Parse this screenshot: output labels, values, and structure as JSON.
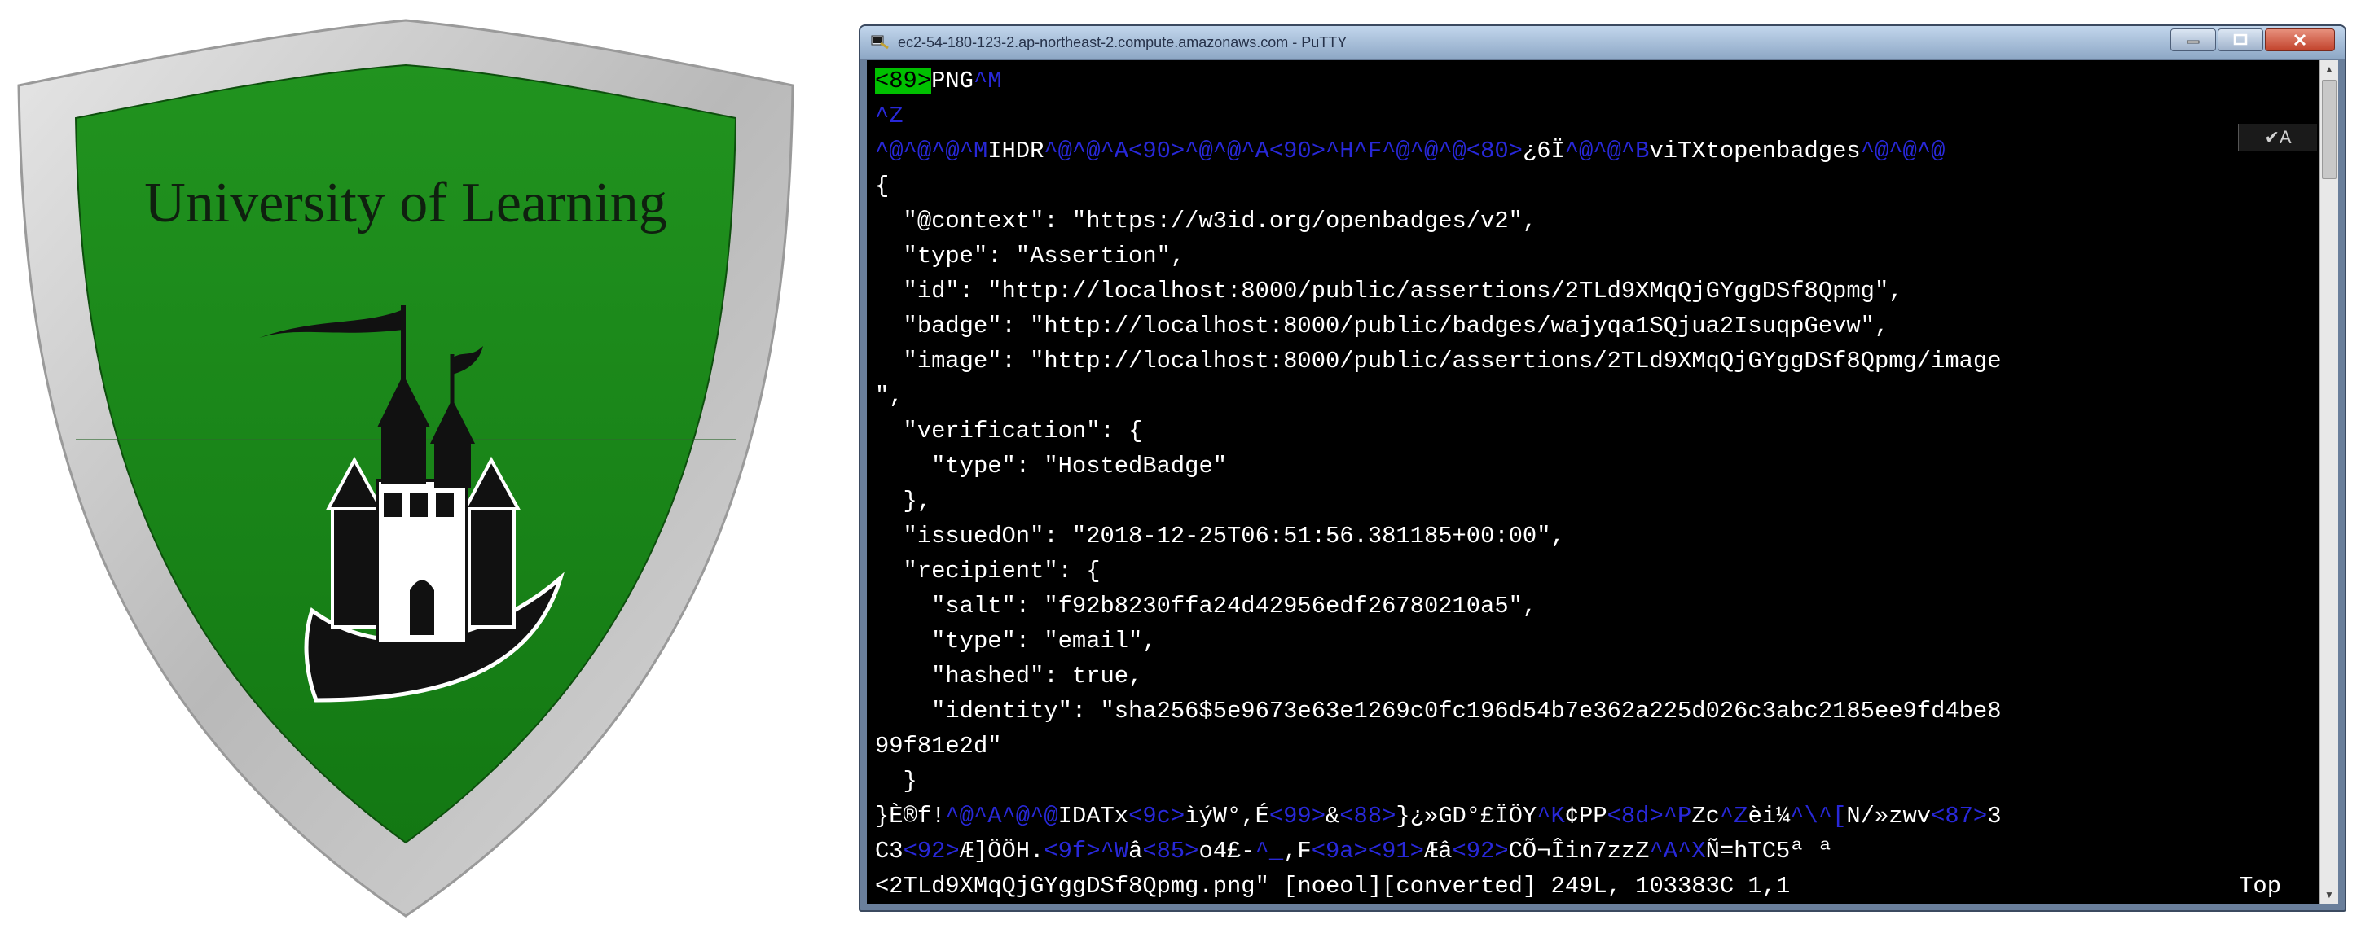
{
  "badge": {
    "title": "University of Learning",
    "colors": {
      "shield_border": "#c4c4c4",
      "shield_fill": "#1e8a1e",
      "ink": "#111111"
    }
  },
  "window": {
    "title": "ec2-54-180-123-2.ap-northeast-2.compute.amazonaws.com - PuTTY",
    "icon": "putty-icon",
    "controls": [
      "minimize-icon",
      "maximize-icon",
      "close-icon"
    ]
  },
  "terminal": {
    "segments": [
      [
        {
          "t": "<89>",
          "c": "cursor"
        },
        {
          "t": "PNG"
        },
        {
          "t": "^M",
          "c": "ctrl"
        }
      ],
      [
        {
          "t": "^Z",
          "c": "ctrl"
        }
      ],
      [
        {
          "t": "^@^@^@^M",
          "c": "ctrl"
        },
        {
          "t": "IHDR"
        },
        {
          "t": "^@^@^A<90>^@^@^A<90>^H^F^@^@^@<80>",
          "c": "ctrl"
        },
        {
          "t": "¿6Ï"
        },
        {
          "t": "^@^@^B",
          "c": "ctrl"
        },
        {
          "t": "viTXtopenbadges"
        },
        {
          "t": "^@^@^@",
          "c": "ctrl"
        }
      ],
      [
        {
          "t": "{"
        }
      ],
      [
        {
          "t": "  \"@context\": \"https://w3id.org/openbadges/v2\","
        }
      ],
      [
        {
          "t": "  \"type\": \"Assertion\","
        }
      ],
      [
        {
          "t": "  \"id\": \"http://localhost:8000/public/assertions/2TLd9XMqQjGYggDSf8Qpmg\","
        }
      ],
      [
        {
          "t": "  \"badge\": \"http://localhost:8000/public/badges/wajyqa1SQjua2IsuqpGevw\","
        }
      ],
      [
        {
          "t": "  \"image\": \"http://localhost:8000/public/assertions/2TLd9XMqQjGYggDSf8Qpmg/image"
        }
      ],
      [
        {
          "t": "\","
        }
      ],
      [
        {
          "t": "  \"verification\": {"
        }
      ],
      [
        {
          "t": "    \"type\": \"HostedBadge\""
        }
      ],
      [
        {
          "t": "  },"
        }
      ],
      [
        {
          "t": "  \"issuedOn\": \"2018-12-25T06:51:56.381185+00:00\","
        }
      ],
      [
        {
          "t": "  \"recipient\": {"
        }
      ],
      [
        {
          "t": "    \"salt\": \"f92b8230ffa24d42956edf26780210a5\","
        }
      ],
      [
        {
          "t": "    \"type\": \"email\","
        }
      ],
      [
        {
          "t": "    \"hashed\": true,"
        }
      ],
      [
        {
          "t": "    \"identity\": \"sha256$5e9673e63e1269c0fc196d54b7e362a225d026c3abc2185ee9fd4be8"
        }
      ],
      [
        {
          "t": "99f81e2d\""
        }
      ],
      [
        {
          "t": "  }"
        }
      ],
      [
        {
          "t": "}È®f!"
        },
        {
          "t": "^@^A^@^@",
          "c": "ctrl"
        },
        {
          "t": "IDATx"
        },
        {
          "t": "<9c>",
          "c": "ctrl"
        },
        {
          "t": "ìýW°,É"
        },
        {
          "t": "<99>",
          "c": "ctrl"
        },
        {
          "t": "&"
        },
        {
          "t": "<88>",
          "c": "ctrl"
        },
        {
          "t": "}¿»GD°£ÏÖY"
        },
        {
          "t": "^K",
          "c": "ctrl"
        },
        {
          "t": "¢PP"
        },
        {
          "t": "<8d>^P",
          "c": "ctrl"
        },
        {
          "t": "Zc"
        },
        {
          "t": "^Z",
          "c": "ctrl"
        },
        {
          "t": "èi¼"
        },
        {
          "t": "^\\^[",
          "c": "ctrl"
        },
        {
          "t": "N/»zwv"
        },
        {
          "t": "<87>",
          "c": "ctrl"
        },
        {
          "t": "3"
        }
      ],
      [
        {
          "t": "C3"
        },
        {
          "t": "<92>",
          "c": "ctrl"
        },
        {
          "t": "Æ]ÖÖH."
        },
        {
          "t": "<9f>^W",
          "c": "ctrl"
        },
        {
          "t": "â"
        },
        {
          "t": "<85>",
          "c": "ctrl"
        },
        {
          "t": "o4£-"
        },
        {
          "t": "^_",
          "c": "ctrl"
        },
        {
          "t": ",F"
        },
        {
          "t": "<9a><91>",
          "c": "ctrl"
        },
        {
          "t": "Æâ"
        },
        {
          "t": "<92>",
          "c": "ctrl"
        },
        {
          "t": "CÕ¬Îin7zzZ"
        },
        {
          "t": "^A^X",
          "c": "ctrl"
        },
        {
          "t": "Ñ=hTC5ª ª"
        }
      ]
    ],
    "status": {
      "file": "<2TLd9XMqQjGYggDSf8Qpmg.png\" [noeol][converted] 249L, 103383C 1,1",
      "position": "Top"
    },
    "overlay": "✔A"
  }
}
